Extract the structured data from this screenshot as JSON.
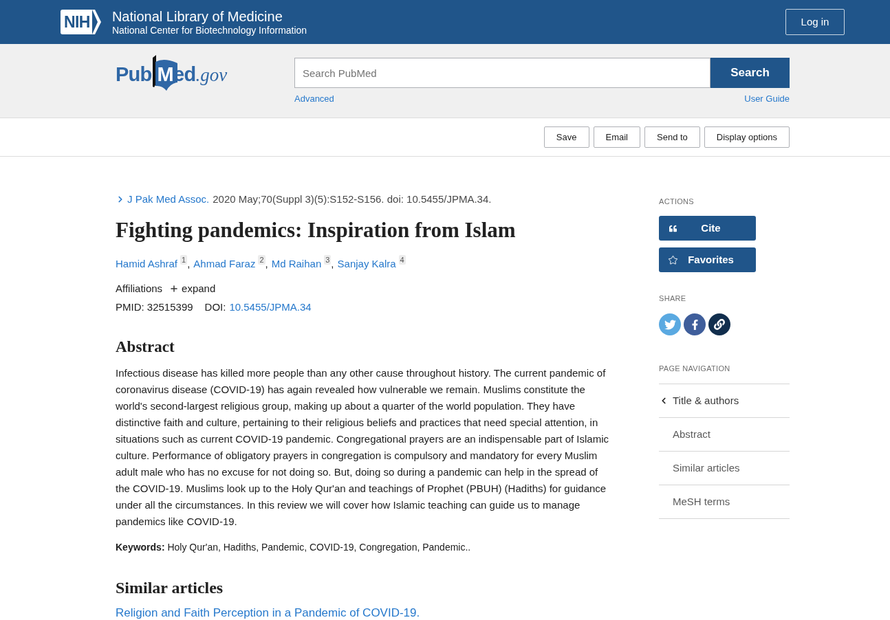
{
  "header": {
    "logo": "NIH",
    "title": "National Library of Medicine",
    "subtitle": "National Center for Biotechnology Information",
    "login_button": "Log in"
  },
  "search_bar": {
    "logo": {
      "name": "PubMed",
      "suffix": ".gov"
    },
    "placeholder": "Search PubMed",
    "button": "Search",
    "links": [
      "Advanced",
      "User Guide"
    ]
  },
  "toolbar": {
    "buttons": [
      "Save",
      "Email",
      "Send to",
      "Display options"
    ]
  },
  "article": {
    "journal": "J Pak Med Assoc.",
    "citation": "2020 May;70(Suppl 3)(5):S152-S156. doi: 10.5455/JPMA.34.",
    "title": "Fighting pandemics: Inspiration from Islam",
    "authors": [
      {
        "name": "Hamid Ashraf",
        "affiliation": "1",
        "separator": ","
      },
      {
        "name": "Ahmad Faraz",
        "affiliation": "2",
        "separator": ","
      },
      {
        "name": "Md Raihan",
        "affiliation": "3",
        "separator": ","
      },
      {
        "name": "Sanjay Kalra",
        "affiliation": "4"
      }
    ],
    "affiliations": {
      "label": "Affiliations",
      "toggle": "expand"
    },
    "pmid": "PMID: 32515399",
    "doi_label": "DOI:",
    "doi": "10.5455/JPMA.34",
    "abstract_heading": "Abstract",
    "abstract": "Infectious disease has killed more people than any other cause throughout history. The current pandemic of coronavirus disease (COVID-19) has again revealed how vulnerable we remain. Muslims constitute the world's second-largest religious group, making up about a quarter of the world population. They have distinctive faith and culture, pertaining to their religious beliefs and practices that need special attention, in situations such as current COVID-19 pandemic. Congregational prayers are an indispensable part of Islamic culture. Performance of obligatory prayers in congregation is compulsory and mandatory for every Muslim adult male who has no excuse for not doing so. But, doing so during a pandemic can help in the spread of the COVID-19. Muslims look up to the Holy Qur'an and teachings of Prophet (PBUH) (Hadiths) for guidance under all the circumstances. In this review we will cover how Islamic teaching can guide us to manage pandemics like COVID-19.",
    "keywords": "**Keywords:** Holy Qur'an, Hadiths, Pandemic, COVID-19, Congregation, Pandemic..",
    "similar_articles": {
      "heading": "Similar articles",
      "items": [
        "Religion and Faith Perception in a Pandemic of COVID-19."
      ]
    }
  },
  "sidebar": {
    "actions_label": "ACTIONS",
    "actions": [
      {
        "label": "Cite",
        "kind": "cite"
      },
      {
        "label": "Favorites",
        "kind": "favorite"
      }
    ],
    "share_label": "SHARE",
    "share": [
      {
        "kind": "twitter"
      },
      {
        "kind": "facebook"
      },
      {
        "kind": "link"
      }
    ],
    "navigation_label": "PAGE NAVIGATION",
    "navigation": [
      {
        "label": "Title & authors",
        "selected": true
      },
      {
        "label": "Abstract",
        "selected": false
      },
      {
        "label": "Similar articles",
        "selected": false
      },
      {
        "label": "MeSH terms",
        "selected": false
      }
    ]
  }
}
